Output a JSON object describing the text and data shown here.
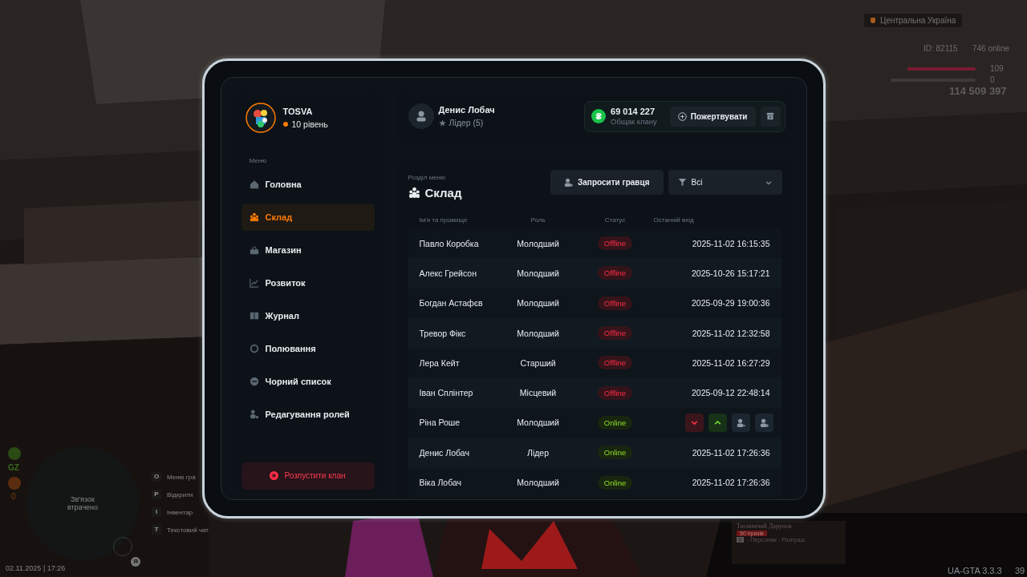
{
  "hud": {
    "region": "Центральна Україна",
    "player_id": "ID: 82115",
    "online": "746 online",
    "health": {
      "level": 0.8,
      "reading": "109"
    },
    "armor": {
      "reading": "0"
    },
    "money": "114 509 397",
    "zone": "GZ",
    "wanted": "0",
    "minimap_text": "Зв'язок втрачено",
    "voice_key": "Я",
    "hotkeys": [
      {
        "key": "O",
        "label": "Меню гра"
      },
      {
        "key": "P",
        "label": "Відкрити"
      },
      {
        "key": "I",
        "label": "Інвентар"
      },
      {
        "key": "T",
        "label": "Текстовий чат"
      }
    ],
    "datetime": "02.11.2025 | 17:26",
    "promo": {
      "title": "Таємничий Дарунок",
      "badge": "50 призів",
      "key": "0",
      "caption": "- Персонаж - Розіграш"
    },
    "version": "UA-GTA 3.3.3",
    "fps": "39"
  },
  "clan": {
    "name": "TOSVA",
    "level": "10 рівень"
  },
  "menu_label": "Меню",
  "menu": [
    {
      "label": "Головна",
      "selected": false
    },
    {
      "label": "Склад",
      "selected": true
    },
    {
      "label": "Магазин",
      "selected": false
    },
    {
      "label": "Розвиток",
      "selected": false
    },
    {
      "label": "Журнал",
      "selected": false
    },
    {
      "label": "Полювання",
      "selected": false
    },
    {
      "label": "Чорний список",
      "selected": false
    },
    {
      "label": "Редагування ролей",
      "selected": false
    }
  ],
  "dissolve_button": "Розпустити клан",
  "user": {
    "name": "Денис Лобач",
    "role": "Лідер (5)"
  },
  "treasury": {
    "currency_symbol": "₴",
    "amount": "69 014 227",
    "caption": "Общак клану",
    "donate_button": "Пожертвувати"
  },
  "section": {
    "caption": "Розділ меню",
    "title": "Склад",
    "invite_button": "Запросити гравця",
    "filter": "Всі"
  },
  "table": {
    "columns": [
      "Ім'я та прізвище",
      "Роль",
      "Статус",
      "Останній вхід"
    ],
    "rows": [
      {
        "name": "Павло Коробка",
        "role": "Молодший",
        "status": {
          "kind": "offline",
          "label": "Offline"
        },
        "last_login": "2025-11-02 16:15:35"
      },
      {
        "name": "Алекс Грейсон",
        "role": "Молодший",
        "status": {
          "kind": "offline",
          "label": "Offline"
        },
        "last_login": "2025-10-26 15:17:21"
      },
      {
        "name": "Богдан Астафєв",
        "role": "Молодший",
        "status": {
          "kind": "offline",
          "label": "Offline"
        },
        "last_login": "2025-09-29 19:00:36"
      },
      {
        "name": "Тревор Фікс",
        "role": "Молодший",
        "status": {
          "kind": "offline",
          "label": "Offline"
        },
        "last_login": "2025-11-02 12:32:58"
      },
      {
        "name": "Лера Кейт",
        "role": "Старший",
        "status": {
          "kind": "offline",
          "label": "Offline"
        },
        "last_login": "2025-11-02 16:27:29"
      },
      {
        "name": "Іван Сплінтер",
        "role": "Місцевий",
        "status": {
          "kind": "offline",
          "label": "Offline"
        },
        "last_login": "2025-09-12 22:48:14"
      },
      {
        "name": "Ріна Роше",
        "role": "Молодший",
        "status": {
          "kind": "online",
          "label": "Online"
        },
        "actions": [
          {
            "kind": "demote"
          },
          {
            "kind": "promote"
          },
          {
            "kind": "kick"
          },
          {
            "kind": "invite"
          }
        ]
      },
      {
        "name": "Денис Лобач",
        "role": "Лідер",
        "status": {
          "kind": "online",
          "label": "Online"
        },
        "last_login": "2025-11-02 17:26:36"
      },
      {
        "name": "Віка Лобач",
        "role": "Молодший",
        "status": {
          "kind": "online",
          "label": "Online"
        },
        "last_login": "2025-11-02 17:26:36"
      }
    ]
  }
}
